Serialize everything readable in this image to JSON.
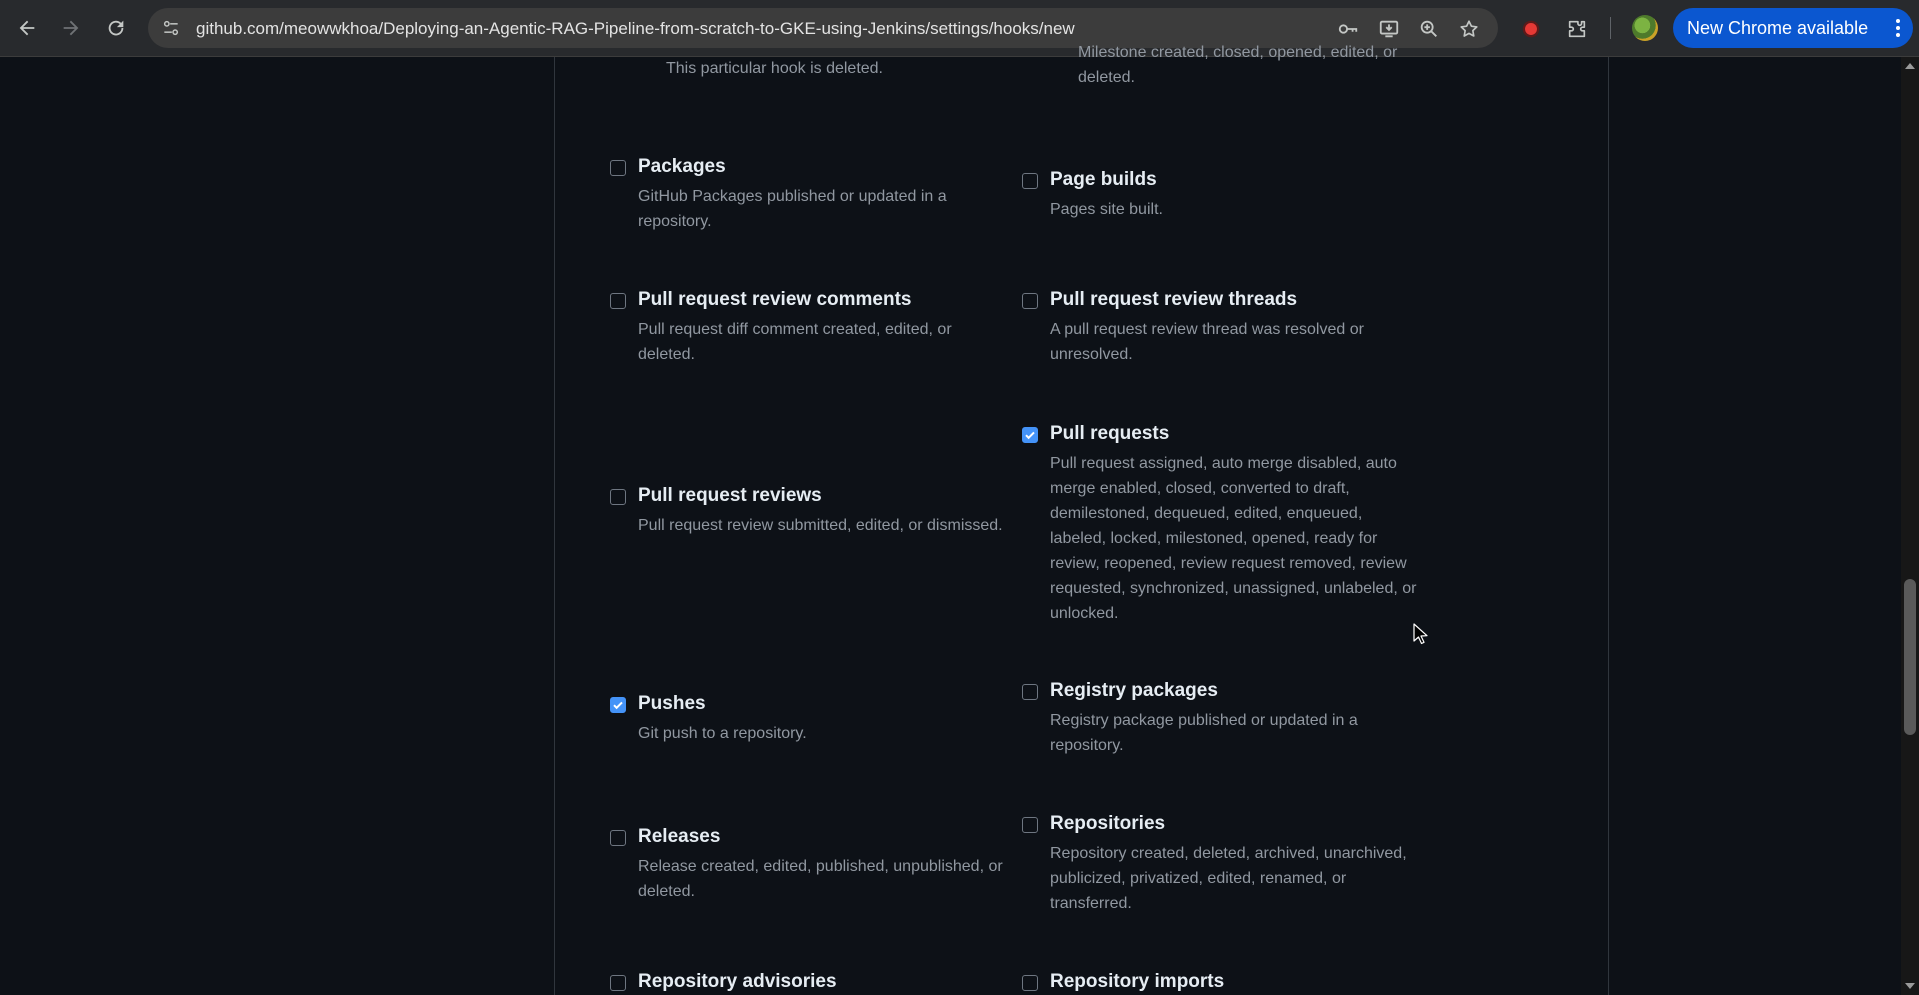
{
  "browser": {
    "url": "github.com/meowwkhoa/Deploying-an-Agentic-RAG-Pipeline-from-scratch-to-GKE-using-Jenkins/settings/hooks/new",
    "update_label": "New Chrome available",
    "icons": [
      "back-arrow-icon",
      "forward-arrow-icon",
      "reload-icon",
      "site-info-icon",
      "password-key-icon",
      "install-app-icon",
      "zoom-icon",
      "bookmark-star-icon",
      "record-icon",
      "extensions-puzzle-icon",
      "profile-avatar",
      "more-vert-icon"
    ]
  },
  "colors": {
    "page_bg": "#0d1117",
    "title": "#e6edf3",
    "description": "#9198a1",
    "checkbox_checked": "#4493f8",
    "update_button": "#0b57d0"
  },
  "events": {
    "deleted_tail": {
      "desc": "This particular hook is deleted."
    },
    "milestone_tail": {
      "desc": "Milestone created, closed, opened, edited, or deleted."
    },
    "packages": {
      "title": "Packages",
      "desc": "GitHub Packages published or updated in a repository.",
      "checked": false
    },
    "page_builds": {
      "title": "Page builds",
      "desc": "Pages site built.",
      "checked": false
    },
    "pr_review_comments": {
      "title": "Pull request review comments",
      "desc": "Pull request diff comment created, edited, or deleted.",
      "checked": false
    },
    "pr_review_threads": {
      "title": "Pull request review threads",
      "desc": "A pull request review thread was resolved or unresolved.",
      "checked": false
    },
    "pull_requests": {
      "title": "Pull requests",
      "desc": "Pull request assigned, auto merge disabled, auto merge enabled, closed, converted to draft, demilestoned, dequeued, edited, enqueued, labeled, locked, milestoned, opened, ready for review, reopened, review request removed, review requested, synchronized, unassigned, unlabeled, or unlocked.",
      "checked": true
    },
    "pr_reviews": {
      "title": "Pull request reviews",
      "desc": "Pull request review submitted, edited, or dismissed.",
      "checked": false
    },
    "pushes": {
      "title": "Pushes",
      "desc": "Git push to a repository.",
      "checked": true
    },
    "registry_packages": {
      "title": "Registry packages",
      "desc": "Registry package published or updated in a repository.",
      "checked": false
    },
    "releases": {
      "title": "Releases",
      "desc": "Release created, edited, published, unpublished, or deleted.",
      "checked": false
    },
    "repositories": {
      "title": "Repositories",
      "desc": "Repository created, deleted, archived, unarchived, publicized, privatized, edited, renamed, or transferred.",
      "checked": false
    },
    "repo_advisories": {
      "title": "Repository advisories",
      "checked": false
    },
    "repo_imports": {
      "title": "Repository imports",
      "checked": false
    }
  }
}
